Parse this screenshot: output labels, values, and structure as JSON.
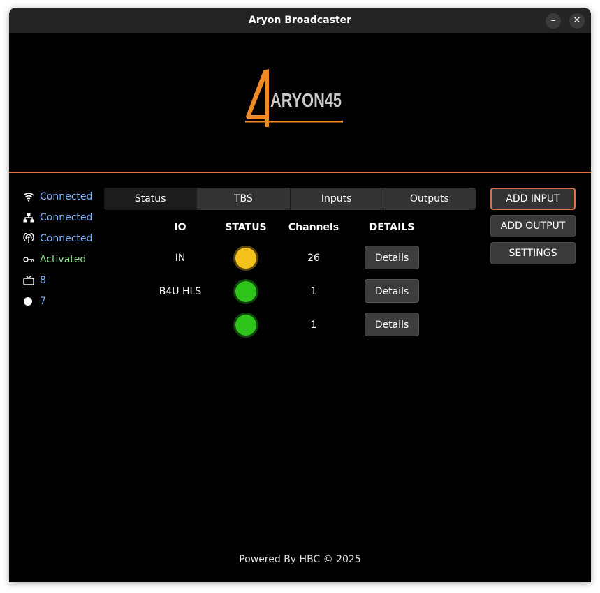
{
  "window": {
    "title": "Aryon Broadcaster",
    "minimize_icon": "minimize-icon",
    "close_icon": "close-icon"
  },
  "logo": {
    "text": "ARYON45",
    "accent_color": "#f08a24"
  },
  "sidebar": {
    "items": [
      {
        "icon": "wifi-icon",
        "label": "Connected",
        "color": "#80b4ff"
      },
      {
        "icon": "network-icon",
        "label": "Connected",
        "color": "#80b4ff"
      },
      {
        "icon": "antenna-icon",
        "label": "Connected",
        "color": "#80b4ff"
      },
      {
        "icon": "key-icon",
        "label": "Activated",
        "color": "#8fdf8f"
      },
      {
        "icon": "tv-icon",
        "label": "8",
        "color": "#80b4ff"
      },
      {
        "icon": "dot-icon",
        "label": "7",
        "color": "#80b4ff"
      }
    ]
  },
  "tabs": [
    {
      "label": "Status",
      "selected": true
    },
    {
      "label": "TBS",
      "selected": false
    },
    {
      "label": "Inputs",
      "selected": false
    },
    {
      "label": "Outputs",
      "selected": false
    }
  ],
  "table": {
    "headers": [
      "IO",
      "STATUS",
      "Channels",
      "DETAILS"
    ],
    "rows": [
      {
        "io": "IN",
        "status_color": "#f5c21b",
        "channels": "26",
        "details_label": "Details"
      },
      {
        "io": "B4U HLS",
        "status_color": "#2ec41a",
        "channels": "1",
        "details_label": "Details"
      },
      {
        "io": "",
        "status_color": "#2ec41a",
        "channels": "1",
        "details_label": "Details"
      }
    ]
  },
  "actions": {
    "add_input": "ADD INPUT",
    "add_output": "ADD OUTPUT",
    "settings": "SETTINGS"
  },
  "footer": {
    "text": "Powered By HBC © 2025"
  },
  "colors": {
    "accent": "#d4734d",
    "status_link": "#80b4ff",
    "activated": "#8fdf8f"
  }
}
